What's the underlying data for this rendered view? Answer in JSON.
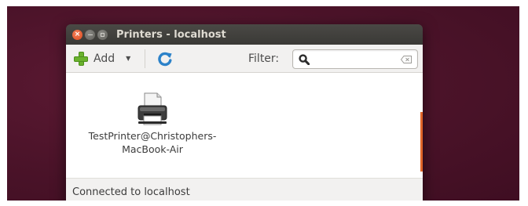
{
  "window": {
    "title": "Printers - localhost"
  },
  "toolbar": {
    "add_label": "Add",
    "add_icon": "plus-icon",
    "refresh_icon": "refresh-icon",
    "filter_label": "Filter:",
    "filter_value": "",
    "accent_green": "#6ab22e",
    "refresh_blue": "#2c82c9"
  },
  "printers": [
    {
      "line1": "TestPrinter@Christophers-",
      "line2": "MacBook-Air",
      "icon": "printer-icon"
    }
  ],
  "status": {
    "text": "Connected to localhost"
  },
  "colors": {
    "desktop": "#4b1329",
    "titlebar": "#3c3b37",
    "close_button": "#df4a1e",
    "scroll_accent": "#e0662a"
  }
}
